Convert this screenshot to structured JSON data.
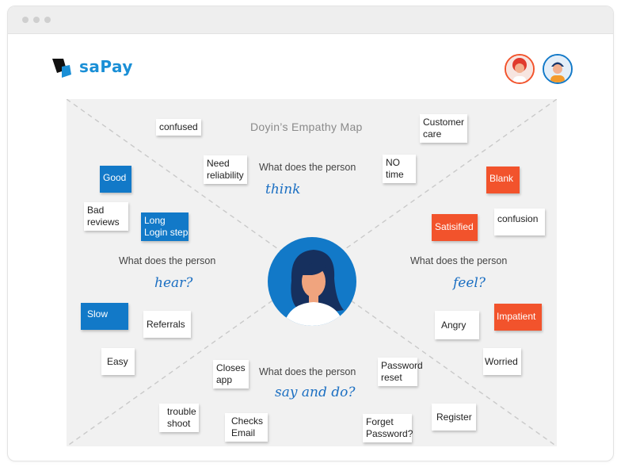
{
  "app": {
    "name": "saPay"
  },
  "colors": {
    "accent_blue": "#1279c8",
    "accent_orange": "#f2532c",
    "board_bg": "#f1f1f1"
  },
  "board": {
    "title": "Doyin’s Empathy Map",
    "quadrants": {
      "think": {
        "question": "What does the person",
        "verb": "think"
      },
      "hear": {
        "question": "What does the person",
        "verb": "hear?"
      },
      "feel": {
        "question": "What does the person",
        "verb": "feel?"
      },
      "say_do": {
        "question": "What does the person",
        "verb": "say and do?"
      }
    },
    "notes": {
      "confused": "confused",
      "customer_care": [
        "Customer",
        "care"
      ],
      "need_reliability": [
        "Need",
        "reliability"
      ],
      "no_time": [
        "NO",
        "time"
      ],
      "good": "Good",
      "blank": "Blank",
      "bad_reviews": [
        "Bad",
        "reviews"
      ],
      "long_login": [
        "Long",
        "Login steps"
      ],
      "satisfied": "Satisified",
      "confusion": "confusion",
      "slow": "Slow",
      "referrals": "Referrals",
      "angry": "Angry",
      "impatient": "Impatient",
      "easy": "Easy",
      "worried": "Worried",
      "closes_app": [
        "Closes",
        "app"
      ],
      "password_reset": [
        "Password",
        "reset"
      ],
      "trouble_shoot": [
        "trouble",
        "shoot"
      ],
      "checks_email": [
        "Checks",
        "Email"
      ],
      "forget_password": [
        "Forget",
        "Password?"
      ],
      "register": "Register"
    }
  }
}
